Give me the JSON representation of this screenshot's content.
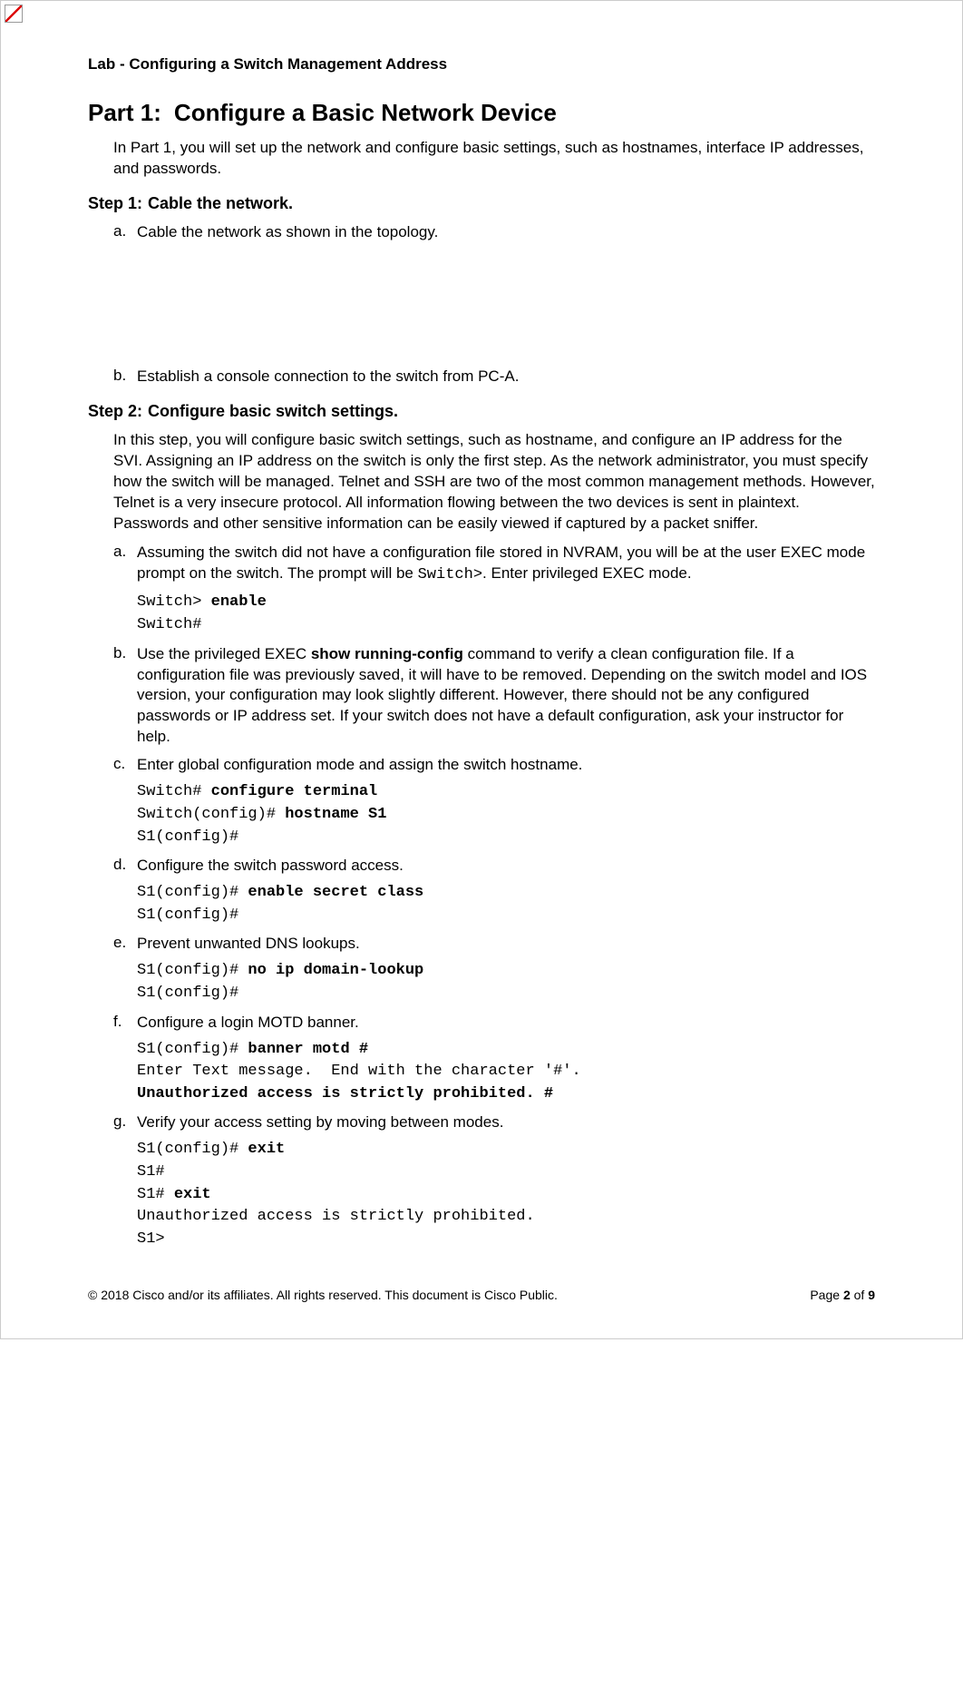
{
  "lab_title": "Lab - Configuring a Switch Management Address",
  "part": {
    "prefix": "Part 1:",
    "title": "Configure a Basic Network Device",
    "intro": "In Part 1, you will set up the network and configure basic settings, such as hostnames, interface IP addresses, and passwords."
  },
  "step1": {
    "prefix": "Step 1:",
    "title": "Cable the network.",
    "a": {
      "letter": "a.",
      "text": "Cable the network as shown in the topology."
    },
    "b": {
      "letter": "b.",
      "text": "Establish a console connection to the switch from PC-A."
    }
  },
  "step2": {
    "prefix": "Step 2:",
    "title": "Configure basic switch settings.",
    "intro": "In this step, you will configure basic switch settings, such as hostname, and configure an IP address for the SVI. Assigning an IP address on the switch is only the first step. As the network administrator, you must specify how the switch will be managed. Telnet and SSH are two of the most common management methods. However, Telnet is a very insecure protocol. All information flowing between the two devices is sent in plaintext. Passwords and other sensitive information can be easily viewed if captured by a packet sniffer.",
    "a": {
      "letter": "a.",
      "text_before": "Assuming the switch did not have a configuration file stored in NVRAM, you will be at the user EXEC mode prompt on the switch. The prompt will be ",
      "prompt": "Switch>",
      "text_after": ". Enter privileged EXEC mode.",
      "code1_prompt": "Switch> ",
      "code1_cmd": "enable",
      "code2": "Switch#"
    },
    "b": {
      "letter": "b.",
      "text_before": "Use the privileged EXEC ",
      "cmd": "show running-config",
      "text_after": " command to verify a clean configuration file. If a configuration file was previously saved, it will have to be removed. Depending on the switch model and IOS version, your configuration may look slightly different. However, there should not be any configured passwords or IP address set. If your switch does not have a default configuration, ask your instructor for help."
    },
    "c": {
      "letter": "c.",
      "text": "Enter global configuration mode and assign the switch hostname.",
      "code1_prompt": "Switch# ",
      "code1_cmd": "configure terminal",
      "code2_prompt": "Switch(config)# ",
      "code2_cmd": "hostname S1",
      "code3": "S1(config)#"
    },
    "d": {
      "letter": "d.",
      "text": "Configure the switch password access.",
      "code1_prompt": "S1(config)# ",
      "code1_cmd": "enable secret class",
      "code2": "S1(config)#"
    },
    "e": {
      "letter": "e.",
      "text": "Prevent unwanted DNS lookups.",
      "code1_prompt": "S1(config)# ",
      "code1_cmd": "no ip domain-lookup",
      "code2": "S1(config)#"
    },
    "f": {
      "letter": "f.",
      "text": "Configure a login MOTD banner.",
      "code1_prompt": "S1(config)# ",
      "code1_cmd": "banner motd #",
      "code2": "Enter Text message.  End with the character '#'.",
      "code3": "Unauthorized access is strictly prohibited. #"
    },
    "g": {
      "letter": "g.",
      "text": "Verify your access setting by moving between modes.",
      "code1_prompt": "S1(config)# ",
      "code1_cmd": "exit",
      "code2": "S1#",
      "code3_prompt": "S1# ",
      "code3_cmd": "exit",
      "code4": "Unauthorized access is strictly prohibited.",
      "code5": "S1>"
    }
  },
  "footer": {
    "left": "© 2018 Cisco and/or its affiliates. All rights reserved. This document is Cisco Public.",
    "page_label": "Page ",
    "page_num": "2",
    "of_label": " of ",
    "total": "9"
  }
}
